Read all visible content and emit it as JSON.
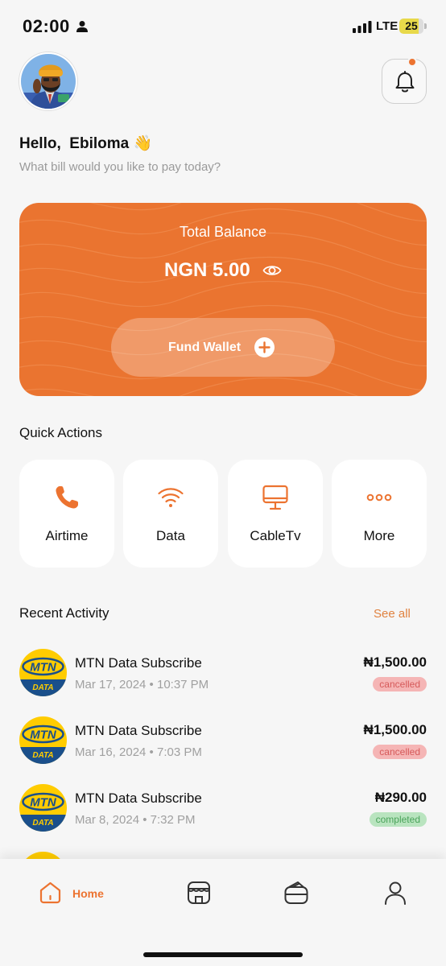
{
  "status_bar": {
    "time": "02:00",
    "network": "LTE",
    "battery_level": "25",
    "battery_fraction": 0.25,
    "icons": [
      "person-icon",
      "signal-bars-icon"
    ]
  },
  "header": {
    "avatar_icon": "user-avatar",
    "notification_icon": "bell-icon",
    "has_unread_notification": true,
    "greeting": "Hello,  Ebiloma 👋",
    "subtitle": "What bill would you like to pay today?"
  },
  "balance_card": {
    "label": "Total Balance",
    "amount": "NGN 5.00",
    "visibility_icon": "eye-icon",
    "fund_button_label": "Fund Wallet",
    "fund_button_icon": "plus-circle-icon",
    "color": "#ea7430"
  },
  "quick_actions": {
    "title": "Quick Actions",
    "items": [
      {
        "label": "Airtime",
        "icon": "phone-icon"
      },
      {
        "label": "Data",
        "icon": "wifi-icon"
      },
      {
        "label": "CableTv",
        "icon": "monitor-icon"
      },
      {
        "label": "More",
        "icon": "more-dots-icon"
      }
    ]
  },
  "recent_activity": {
    "title": "Recent Activity",
    "see_all_label": "See all",
    "items": [
      {
        "title": "MTN Data Subscribe",
        "date": "Mar 17, 2024 • 10:37 PM",
        "amount": "₦1,500.00",
        "status": "cancelled"
      },
      {
        "title": "MTN Data Subscribe",
        "date": "Mar 16, 2024 • 7:03 PM",
        "amount": "₦1,500.00",
        "status": "cancelled"
      },
      {
        "title": "MTN Data Subscribe",
        "date": "Mar 8, 2024 • 7:32 PM",
        "amount": "₦290.00",
        "status": "completed"
      }
    ],
    "logo_text": {
      "brand": "MTN",
      "sub": "DATA"
    }
  },
  "tab_bar": {
    "active": "Home",
    "tabs": [
      {
        "label": "Home",
        "icon": "home-icon"
      },
      {
        "label": "",
        "icon": "store-icon"
      },
      {
        "label": "",
        "icon": "wallet-icon"
      },
      {
        "label": "",
        "icon": "profile-icon"
      }
    ]
  },
  "colors": {
    "accent": "#ec7330",
    "background": "#f6f6f6",
    "cancelled_bg": "#f5b5b5",
    "completed_bg": "#b9e4bf"
  }
}
